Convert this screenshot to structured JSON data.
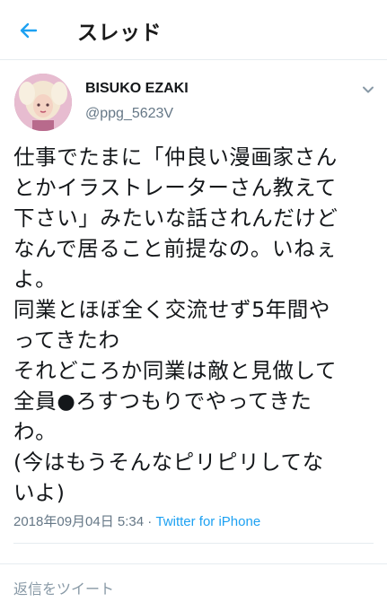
{
  "header": {
    "back_icon": "arrow-left-icon",
    "title": "スレッド",
    "accent_color": "#1da1f2"
  },
  "tweet": {
    "author": {
      "name": "BISUKO EZAKI",
      "handle": "@ppg_5623V"
    },
    "menu_icon": "chevron-down-icon",
    "lines": [
      "仕事でたまに「仲良い漫画家さん",
      "とかイラストレーターさん教えて",
      "下さい」みたいな話されんだけど",
      "なんで居ること前提なの。いねぇ",
      "よ。",
      "同業とほぼ全く交流せず5年間や",
      "ってきたわ",
      "それどころか同業は敵と見做して",
      "全員●ろすつもりでやってきた",
      "わ。",
      "(今はもうそんなピリピリしてな",
      "いよ)"
    ],
    "timestamp": "2018年09月04日 5:34",
    "separator": " · ",
    "client": "Twitter for iPhone"
  },
  "reply": {
    "placeholder": "返信をツイート"
  }
}
